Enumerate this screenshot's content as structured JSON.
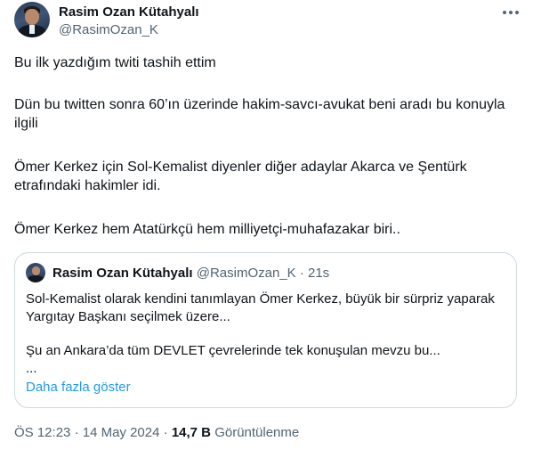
{
  "author": {
    "name": "Rasim Ozan Kütahyalı",
    "handle": "@RasimOzan_K"
  },
  "more_icon": "more-horizontal-icon",
  "tweet": {
    "paragraphs": [
      "Bu ilk yazdığım twiti tashih ettim",
      "Dün bu twitten sonra 60’ın üzerinde hakim-savcı-avukat beni aradı bu konuyla ilgili",
      "Ömer Kerkez için Sol-Kemalist diyenler diğer adaylar Akarca ve Şentürk etrafındaki hakimler idi.",
      "Ömer Kerkez hem Atatürkçü hem milliyetçi-muhafazakar biri.."
    ]
  },
  "quoted": {
    "name": "Rasim Ozan Kütahyalı",
    "handle": "@RasimOzan_K",
    "separator": "·",
    "time": "21s",
    "lines": [
      "Sol-Kemalist olarak kendini tanımlayan Ömer Kerkez, büyük bir sürpriz yaparak Yargıtay Başkanı seçilmek üzere...",
      "Şu an Ankara’da tüm DEVLET çevrelerinde tek konuşulan mevzu bu...",
      "..."
    ],
    "show_more": "Daha fazla göster"
  },
  "meta": {
    "time": "ÖS 12:23",
    "dot1": "·",
    "date": "14 May 2024",
    "dot2": "·",
    "views_count": "14,7 B",
    "views_label": "Görüntülenme"
  },
  "colors": {
    "text": "#0f1419",
    "secondary": "#536471",
    "link": "#1d9bf0",
    "border": "#cfd9de"
  }
}
